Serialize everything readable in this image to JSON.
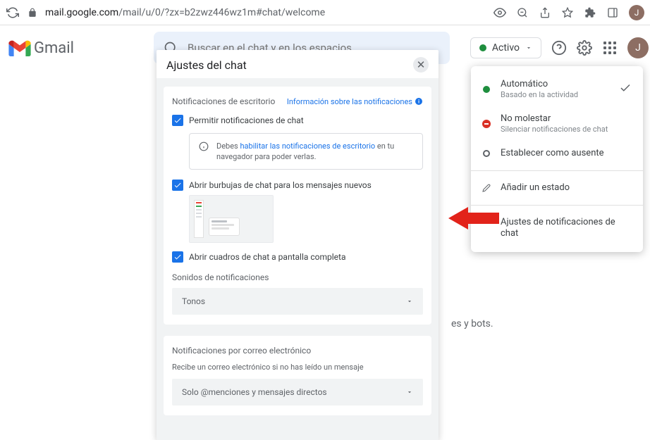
{
  "browser": {
    "domain": "mail.google.com",
    "path": "/mail/u/0/?zx=b2zwz446wz1m#chat/welcome",
    "avatar_letter": "J"
  },
  "header": {
    "app_name": "Gmail",
    "search_placeholder": "Buscar en el chat y en los espacios",
    "status_pill": "Activo",
    "avatar_letter": "J"
  },
  "modal": {
    "title": "Ajustes del chat",
    "section1": {
      "title": "Notificaciones de escritorio",
      "info_link": "Información sobre las notificaciones",
      "cb1_label": "Permitir notificaciones de chat",
      "notice_pre": "Debes ",
      "notice_link": "habilitar las notificaciones de escritorio",
      "notice_post": " en tu navegador para poder verlas.",
      "cb2_label": "Abrir burbujas de chat para los mensajes nuevos",
      "cb3_label": "Abrir cuadros de chat a pantalla completa",
      "sounds_label": "Sonidos de notificaciones",
      "sounds_value": "Tonos"
    },
    "section2": {
      "title": "Notificaciones por correo electrónico",
      "subtitle": "Recibe un correo electrónico si no has leído un mensaje",
      "select_value": "Solo @menciones y mensajes directos"
    }
  },
  "status_menu": {
    "auto_title": "Automático",
    "auto_sub": "Basado en la actividad",
    "dnd_title": "No molestar",
    "dnd_sub": "Silenciar notificaciones de chat",
    "away_title": "Establecer como ausente",
    "add_status": "Añadir un estado",
    "settings": "Ajustes de notificaciones de chat"
  },
  "below_fragment": "es y bots."
}
